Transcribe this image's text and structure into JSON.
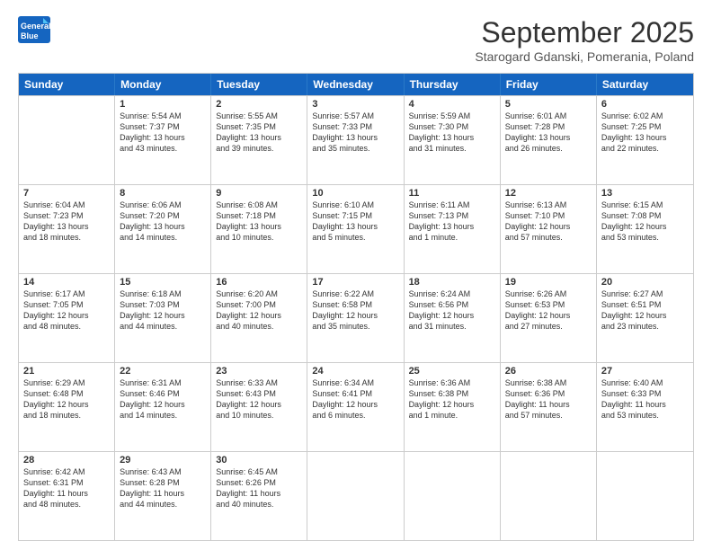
{
  "header": {
    "logo_general": "General",
    "logo_blue": "Blue",
    "month_title": "September 2025",
    "subtitle": "Starogard Gdanski, Pomerania, Poland"
  },
  "weekdays": [
    "Sunday",
    "Monday",
    "Tuesday",
    "Wednesday",
    "Thursday",
    "Friday",
    "Saturday"
  ],
  "rows": [
    [
      {
        "day": "",
        "lines": []
      },
      {
        "day": "1",
        "lines": [
          "Sunrise: 5:54 AM",
          "Sunset: 7:37 PM",
          "Daylight: 13 hours",
          "and 43 minutes."
        ]
      },
      {
        "day": "2",
        "lines": [
          "Sunrise: 5:55 AM",
          "Sunset: 7:35 PM",
          "Daylight: 13 hours",
          "and 39 minutes."
        ]
      },
      {
        "day": "3",
        "lines": [
          "Sunrise: 5:57 AM",
          "Sunset: 7:33 PM",
          "Daylight: 13 hours",
          "and 35 minutes."
        ]
      },
      {
        "day": "4",
        "lines": [
          "Sunrise: 5:59 AM",
          "Sunset: 7:30 PM",
          "Daylight: 13 hours",
          "and 31 minutes."
        ]
      },
      {
        "day": "5",
        "lines": [
          "Sunrise: 6:01 AM",
          "Sunset: 7:28 PM",
          "Daylight: 13 hours",
          "and 26 minutes."
        ]
      },
      {
        "day": "6",
        "lines": [
          "Sunrise: 6:02 AM",
          "Sunset: 7:25 PM",
          "Daylight: 13 hours",
          "and 22 minutes."
        ]
      }
    ],
    [
      {
        "day": "7",
        "lines": [
          "Sunrise: 6:04 AM",
          "Sunset: 7:23 PM",
          "Daylight: 13 hours",
          "and 18 minutes."
        ]
      },
      {
        "day": "8",
        "lines": [
          "Sunrise: 6:06 AM",
          "Sunset: 7:20 PM",
          "Daylight: 13 hours",
          "and 14 minutes."
        ]
      },
      {
        "day": "9",
        "lines": [
          "Sunrise: 6:08 AM",
          "Sunset: 7:18 PM",
          "Daylight: 13 hours",
          "and 10 minutes."
        ]
      },
      {
        "day": "10",
        "lines": [
          "Sunrise: 6:10 AM",
          "Sunset: 7:15 PM",
          "Daylight: 13 hours",
          "and 5 minutes."
        ]
      },
      {
        "day": "11",
        "lines": [
          "Sunrise: 6:11 AM",
          "Sunset: 7:13 PM",
          "Daylight: 13 hours",
          "and 1 minute."
        ]
      },
      {
        "day": "12",
        "lines": [
          "Sunrise: 6:13 AM",
          "Sunset: 7:10 PM",
          "Daylight: 12 hours",
          "and 57 minutes."
        ]
      },
      {
        "day": "13",
        "lines": [
          "Sunrise: 6:15 AM",
          "Sunset: 7:08 PM",
          "Daylight: 12 hours",
          "and 53 minutes."
        ]
      }
    ],
    [
      {
        "day": "14",
        "lines": [
          "Sunrise: 6:17 AM",
          "Sunset: 7:05 PM",
          "Daylight: 12 hours",
          "and 48 minutes."
        ]
      },
      {
        "day": "15",
        "lines": [
          "Sunrise: 6:18 AM",
          "Sunset: 7:03 PM",
          "Daylight: 12 hours",
          "and 44 minutes."
        ]
      },
      {
        "day": "16",
        "lines": [
          "Sunrise: 6:20 AM",
          "Sunset: 7:00 PM",
          "Daylight: 12 hours",
          "and 40 minutes."
        ]
      },
      {
        "day": "17",
        "lines": [
          "Sunrise: 6:22 AM",
          "Sunset: 6:58 PM",
          "Daylight: 12 hours",
          "and 35 minutes."
        ]
      },
      {
        "day": "18",
        "lines": [
          "Sunrise: 6:24 AM",
          "Sunset: 6:56 PM",
          "Daylight: 12 hours",
          "and 31 minutes."
        ]
      },
      {
        "day": "19",
        "lines": [
          "Sunrise: 6:26 AM",
          "Sunset: 6:53 PM",
          "Daylight: 12 hours",
          "and 27 minutes."
        ]
      },
      {
        "day": "20",
        "lines": [
          "Sunrise: 6:27 AM",
          "Sunset: 6:51 PM",
          "Daylight: 12 hours",
          "and 23 minutes."
        ]
      }
    ],
    [
      {
        "day": "21",
        "lines": [
          "Sunrise: 6:29 AM",
          "Sunset: 6:48 PM",
          "Daylight: 12 hours",
          "and 18 minutes."
        ]
      },
      {
        "day": "22",
        "lines": [
          "Sunrise: 6:31 AM",
          "Sunset: 6:46 PM",
          "Daylight: 12 hours",
          "and 14 minutes."
        ]
      },
      {
        "day": "23",
        "lines": [
          "Sunrise: 6:33 AM",
          "Sunset: 6:43 PM",
          "Daylight: 12 hours",
          "and 10 minutes."
        ]
      },
      {
        "day": "24",
        "lines": [
          "Sunrise: 6:34 AM",
          "Sunset: 6:41 PM",
          "Daylight: 12 hours",
          "and 6 minutes."
        ]
      },
      {
        "day": "25",
        "lines": [
          "Sunrise: 6:36 AM",
          "Sunset: 6:38 PM",
          "Daylight: 12 hours",
          "and 1 minute."
        ]
      },
      {
        "day": "26",
        "lines": [
          "Sunrise: 6:38 AM",
          "Sunset: 6:36 PM",
          "Daylight: 11 hours",
          "and 57 minutes."
        ]
      },
      {
        "day": "27",
        "lines": [
          "Sunrise: 6:40 AM",
          "Sunset: 6:33 PM",
          "Daylight: 11 hours",
          "and 53 minutes."
        ]
      }
    ],
    [
      {
        "day": "28",
        "lines": [
          "Sunrise: 6:42 AM",
          "Sunset: 6:31 PM",
          "Daylight: 11 hours",
          "and 48 minutes."
        ]
      },
      {
        "day": "29",
        "lines": [
          "Sunrise: 6:43 AM",
          "Sunset: 6:28 PM",
          "Daylight: 11 hours",
          "and 44 minutes."
        ]
      },
      {
        "day": "30",
        "lines": [
          "Sunrise: 6:45 AM",
          "Sunset: 6:26 PM",
          "Daylight: 11 hours",
          "and 40 minutes."
        ]
      },
      {
        "day": "",
        "lines": []
      },
      {
        "day": "",
        "lines": []
      },
      {
        "day": "",
        "lines": []
      },
      {
        "day": "",
        "lines": []
      }
    ]
  ]
}
